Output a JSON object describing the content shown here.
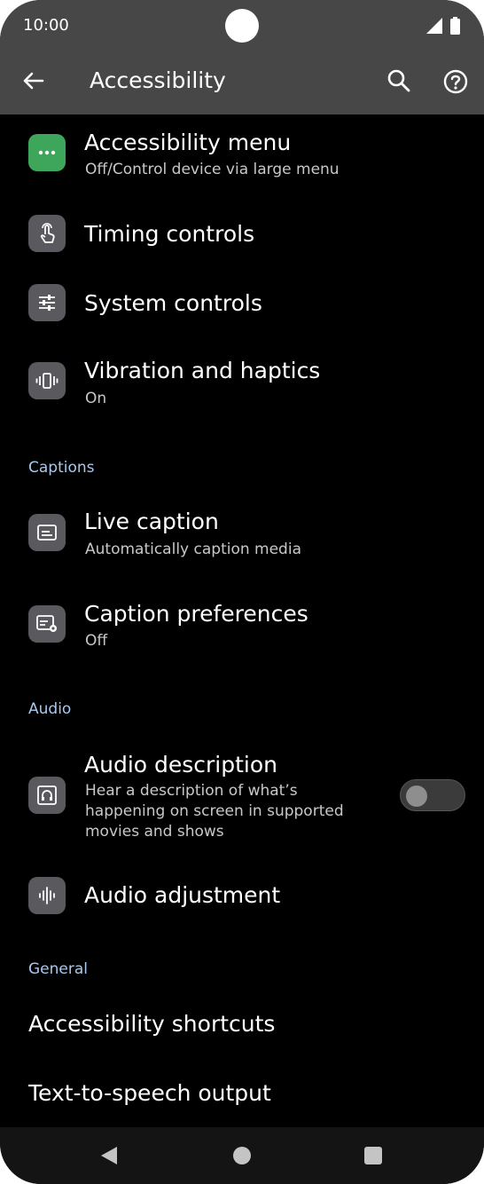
{
  "status_bar": {
    "time": "10:00"
  },
  "app_bar": {
    "title": "Accessibility"
  },
  "items": [
    {
      "title": "Accessibility menu",
      "subtitle": "Off/Control device via large menu",
      "icon": "more-horiz-icon"
    },
    {
      "title": "Timing controls",
      "icon": "touch-hand-icon"
    },
    {
      "title": "System controls",
      "icon": "tune-sliders-icon"
    },
    {
      "title": "Vibration and haptics",
      "subtitle": "On",
      "icon": "vibration-icon"
    }
  ],
  "sections": {
    "captions": "Captions",
    "audio": "Audio",
    "general": "General"
  },
  "captions_items": [
    {
      "title": "Live caption",
      "subtitle": "Automatically caption media",
      "icon": "caption-icon"
    },
    {
      "title": "Caption preferences",
      "subtitle": "Off",
      "icon": "caption-settings-icon"
    }
  ],
  "audio_items": [
    {
      "title": "Audio description",
      "subtitle": "Hear a description of what’s happening on screen in supported movies and shows",
      "icon": "audio-description-icon",
      "toggle_on": false
    },
    {
      "title": "Audio adjustment",
      "icon": "waveform-icon"
    }
  ],
  "general_items": [
    {
      "title": "Accessibility shortcuts"
    },
    {
      "title": "Text-to-speech output"
    }
  ]
}
